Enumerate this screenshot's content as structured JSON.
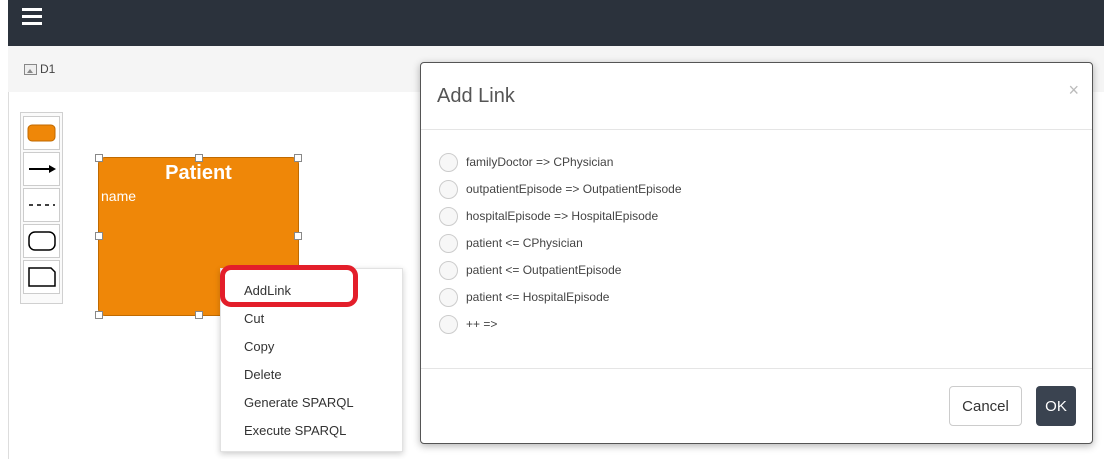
{
  "topbar": {
    "menu_icon": "hamburger-menu-icon"
  },
  "tab": {
    "icon": "image-icon",
    "label": "D1"
  },
  "palette": {
    "items": [
      {
        "name": "class-shape",
        "icon": "filled-rounded-rect-icon",
        "fill": "#ef8708"
      },
      {
        "name": "association-arrow",
        "icon": "solid-arrow-icon"
      },
      {
        "name": "dashed-line",
        "icon": "dashed-line-icon"
      },
      {
        "name": "rounded-box",
        "icon": "rounded-rect-outline-icon"
      },
      {
        "name": "note-box",
        "icon": "folded-note-icon"
      }
    ]
  },
  "node": {
    "title": "Patient",
    "attribute": "name",
    "color": "#ef8708"
  },
  "context_menu": {
    "items": [
      "AddLink",
      "Cut",
      "Copy",
      "Delete",
      "Generate SPARQL",
      "Execute SPARQL"
    ],
    "highlight_color": "#e31e2a"
  },
  "modal": {
    "title": "Add Link",
    "close_icon": "close-icon",
    "close_symbol": "×",
    "options": [
      "familyDoctor => CPhysician",
      "outpatientEpisode => OutpatientEpisode",
      "hospitalEpisode => HospitalEpisode",
      "patient <= CPhysician",
      "patient <= OutpatientEpisode",
      "patient <= HospitalEpisode",
      "++ =>"
    ],
    "cancel_label": "Cancel",
    "ok_label": "OK",
    "ok_color": "#3a4350"
  }
}
